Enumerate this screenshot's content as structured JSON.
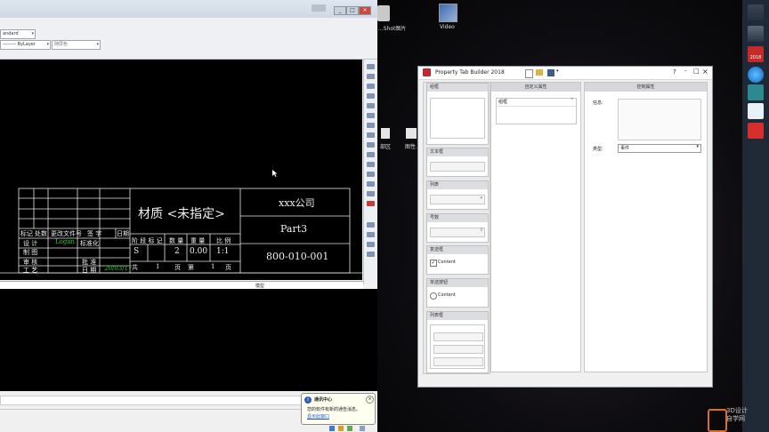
{
  "cad": {
    "layer_combo": "andard",
    "linetype_combo": "ByLayer",
    "color_combo": "随层色",
    "window_controls": [
      "_",
      "□",
      "×"
    ],
    "status_text": "模型",
    "notify": {
      "title": "通讯中心",
      "body": "您的软件有新的通告消息。",
      "link": "显示此窗口"
    }
  },
  "title_block": {
    "material": "材质 <未指定>",
    "company": "xxx公司",
    "part": "Part3",
    "number": "800-010-001",
    "row1": [
      "标记",
      "处数",
      "更改文件号",
      "签 字",
      "日期"
    ],
    "design_label": "设 计",
    "designer": "Logan",
    "standard_label": "标准化",
    "draw_label": "制 图",
    "review_label": "审 核",
    "approve_label": "批 准",
    "process_label": "工 艺",
    "date_label": "日 期",
    "date_value": "20/03/17",
    "stage_headers": [
      "阶 段 标 记",
      "数 量",
      "重 量",
      "比 例"
    ],
    "stage_values": [
      "S",
      "2",
      "0.00",
      "1:1"
    ],
    "sheet": [
      "共",
      "1",
      "页",
      "第",
      "1",
      "页"
    ]
  },
  "desktop": {
    "icon1_label": "...Shot图片",
    "icon2_label": "Video",
    "icon3_label": "部区",
    "icon4_label": "图性..."
  },
  "dialog": {
    "title": "Property Tab Builder 2018",
    "controls": [
      "?",
      "-",
      "□",
      "×"
    ],
    "col1_header": "组框",
    "col2_header": "自定义属性",
    "col3_header": "控制属性",
    "tree_item": "组框",
    "sections": [
      {
        "label": "组框"
      },
      {
        "label": "文本框"
      },
      {
        "label": "列表"
      },
      {
        "label": "号数"
      },
      {
        "label": "复选框",
        "option": "Content"
      },
      {
        "label": "单选按钮",
        "option": "Content"
      },
      {
        "label": "列表框"
      }
    ],
    "caption_label": "信息:",
    "type_label": "类型:",
    "type_value": "事件"
  },
  "taskbar": {
    "icons": [
      "plugin-icon",
      "settings-icon",
      "solidworks-2018-icon",
      "browser-icon",
      "monitor-icon",
      "text-editor-icon",
      "solidworks-icon"
    ],
    "sw_year": "2018",
    "watermark": "3D设计\n自学网"
  }
}
